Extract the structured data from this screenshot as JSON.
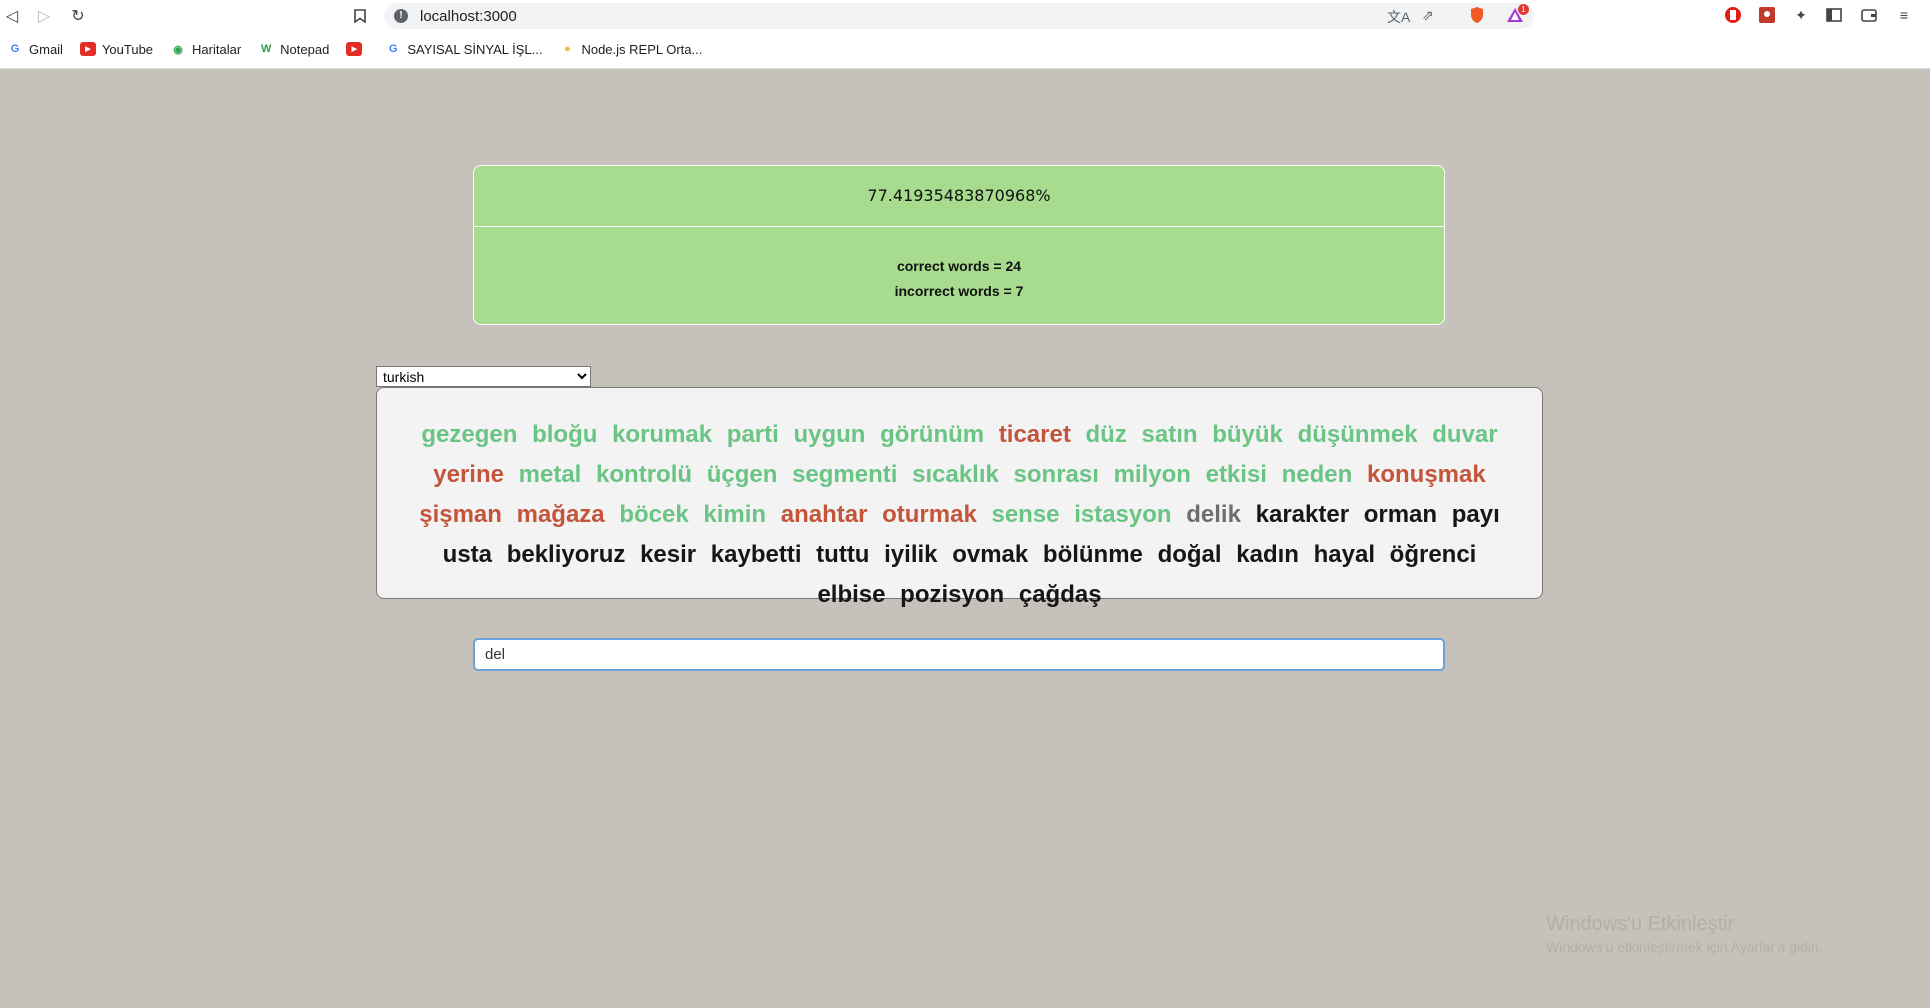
{
  "browser": {
    "url": "localhost:3000",
    "notification_count": "1",
    "bookmarks": [
      {
        "label": "Gmail",
        "icon": "google-icon"
      },
      {
        "label": "YouTube",
        "icon": "youtube-icon"
      },
      {
        "label": "Haritalar",
        "icon": "maps-icon"
      },
      {
        "label": "Notepad",
        "icon": "notepad-icon"
      },
      {
        "label": "",
        "icon": "youtube-icon"
      },
      {
        "label": "SAYISAL SİNYAL İŞL...",
        "icon": "google-icon"
      },
      {
        "label": "Node.js REPL Orta...",
        "icon": "replit-icon"
      }
    ]
  },
  "result": {
    "percentage": "77.41935483870968%",
    "correct_words": "correct words = 24",
    "incorrect_words": "incorrect words = 7"
  },
  "language": {
    "selected": "turkish"
  },
  "words": [
    {
      "text": "gezegen",
      "status": "correct"
    },
    {
      "text": "bloğu",
      "status": "correct"
    },
    {
      "text": "korumak",
      "status": "correct"
    },
    {
      "text": "parti",
      "status": "correct"
    },
    {
      "text": "uygun",
      "status": "correct"
    },
    {
      "text": "görünüm",
      "status": "correct"
    },
    {
      "text": "ticaret",
      "status": "incorrect"
    },
    {
      "text": "düz",
      "status": "correct"
    },
    {
      "text": "satın",
      "status": "correct"
    },
    {
      "text": "büyük",
      "status": "correct"
    },
    {
      "text": "düşünmek",
      "status": "correct"
    },
    {
      "text": "duvar",
      "status": "correct"
    },
    {
      "text": "yerine",
      "status": "incorrect"
    },
    {
      "text": "metal",
      "status": "correct"
    },
    {
      "text": "kontrolü",
      "status": "correct"
    },
    {
      "text": "üçgen",
      "status": "correct"
    },
    {
      "text": "segmenti",
      "status": "correct"
    },
    {
      "text": "sıcaklık",
      "status": "correct"
    },
    {
      "text": "sonrası",
      "status": "correct"
    },
    {
      "text": "milyon",
      "status": "correct"
    },
    {
      "text": "etkisi",
      "status": "correct"
    },
    {
      "text": "neden",
      "status": "correct"
    },
    {
      "text": "konuşmak",
      "status": "incorrect"
    },
    {
      "text": "şişman",
      "status": "incorrect"
    },
    {
      "text": "mağaza",
      "status": "incorrect"
    },
    {
      "text": "böcek",
      "status": "correct"
    },
    {
      "text": "kimin",
      "status": "correct"
    },
    {
      "text": "anahtar",
      "status": "incorrect"
    },
    {
      "text": "oturmak",
      "status": "incorrect"
    },
    {
      "text": "sense",
      "status": "correct"
    },
    {
      "text": "istasyon",
      "status": "correct"
    },
    {
      "text": "delik",
      "status": "current"
    },
    {
      "text": "karakter",
      "status": "pending"
    },
    {
      "text": "orman",
      "status": "pending"
    },
    {
      "text": "payı",
      "status": "pending"
    },
    {
      "text": "usta",
      "status": "pending"
    },
    {
      "text": "bekliyoruz",
      "status": "pending"
    },
    {
      "text": "kesir",
      "status": "pending"
    },
    {
      "text": "kaybetti",
      "status": "pending"
    },
    {
      "text": "tuttu",
      "status": "pending"
    },
    {
      "text": "iyilik",
      "status": "pending"
    },
    {
      "text": "ovmak",
      "status": "pending"
    },
    {
      "text": "bölünme",
      "status": "pending"
    },
    {
      "text": "doğal",
      "status": "pending"
    },
    {
      "text": "kadın",
      "status": "pending"
    },
    {
      "text": "hayal",
      "status": "pending"
    },
    {
      "text": "öğrenci",
      "status": "pending"
    },
    {
      "text": "elbise",
      "status": "pending"
    },
    {
      "text": "pozisyon",
      "status": "pending"
    },
    {
      "text": "çağdaş",
      "status": "pending"
    }
  ],
  "input": {
    "value": "del"
  },
  "watermark": {
    "title": "Windows'u Etkinleştir",
    "subtitle": "Windows'u etkinleştirmek için Ayarlar'a gidin."
  },
  "colors": {
    "page_background": "#c6c1ba",
    "result_background": "#a7db8e",
    "correct": "#6ac584",
    "incorrect": "#c3553b",
    "current": "#6e6e6e",
    "pending": "#161616",
    "input_border": "#6ea1d9"
  }
}
